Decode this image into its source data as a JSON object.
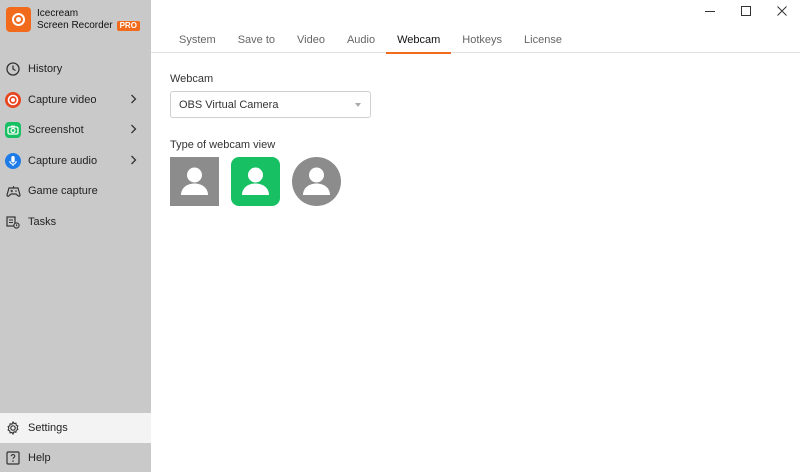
{
  "app": {
    "name_line1": "Icecream",
    "name_line2": "Screen Recorder",
    "badge": "PRO",
    "brand_color": "#f26a1b"
  },
  "sidebar": {
    "items": [
      {
        "label": "History",
        "icon": "clock-icon"
      },
      {
        "label": "Capture video",
        "icon": "record-icon",
        "icon_color": "#e8431f"
      },
      {
        "label": "Screenshot",
        "icon": "camera-icon",
        "icon_color": "#17c163"
      },
      {
        "label": "Capture audio",
        "icon": "microphone-icon",
        "icon_color": "#1e7be8"
      },
      {
        "label": "Game capture",
        "icon": "gamepad-icon"
      },
      {
        "label": "Tasks",
        "icon": "tasks-icon"
      }
    ],
    "bottom": [
      {
        "label": "Settings",
        "icon": "gear-icon",
        "active": true
      },
      {
        "label": "Help",
        "icon": "help-icon"
      }
    ]
  },
  "tabs": [
    {
      "label": "System"
    },
    {
      "label": "Save to"
    },
    {
      "label": "Video"
    },
    {
      "label": "Audio"
    },
    {
      "label": "Webcam",
      "active": true
    },
    {
      "label": "Hotkeys"
    },
    {
      "label": "License"
    }
  ],
  "webcam": {
    "label": "Webcam",
    "selected": "OBS Virtual Camera",
    "view_label": "Type of webcam view",
    "views": [
      {
        "shape": "square",
        "selected": false,
        "color": "#8c8c8c"
      },
      {
        "shape": "rounded",
        "selected": true,
        "color": "#17c163"
      },
      {
        "shape": "circle",
        "selected": false,
        "color": "#8c8c8c"
      }
    ]
  }
}
